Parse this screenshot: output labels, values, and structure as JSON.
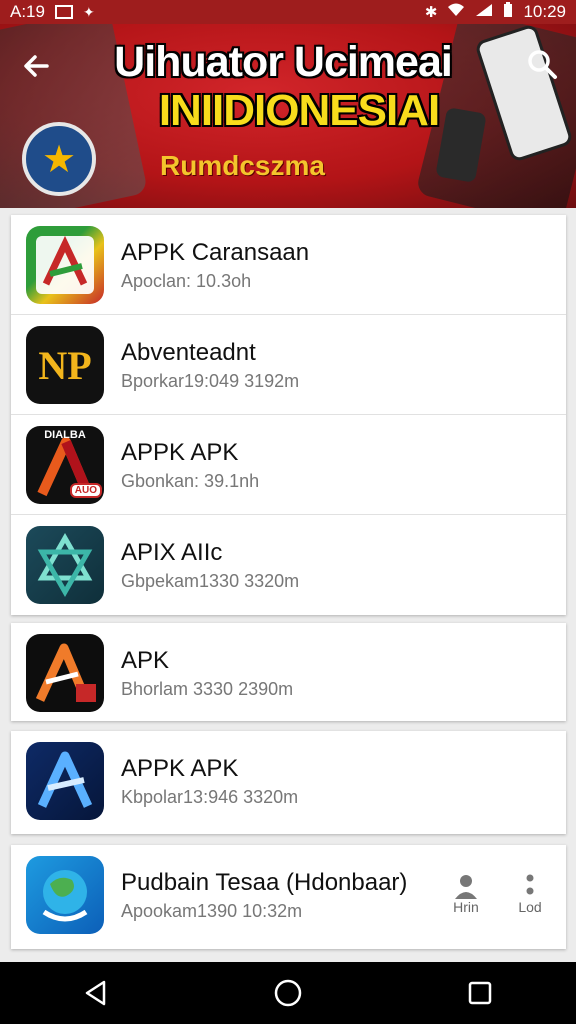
{
  "status_bar": {
    "carrier": "A:19",
    "time": "10:29"
  },
  "banner": {
    "title": "Uihuator Ucimeai",
    "subtitle": "INIIDIONESIAI",
    "tagline": "Rumdcszma",
    "back_icon": "arrow-back-icon",
    "search_icon": "search-icon"
  },
  "apps": [
    {
      "name": "APPK Caransaan",
      "meta": "Apoclan: 10.3oh",
      "icon": "apk-icon-green-red"
    },
    {
      "name": "Abventeadnt",
      "meta": "Bporkar19:049 3192m",
      "icon": "np-icon",
      "icon_text": "NP"
    },
    {
      "name": "APPK APK",
      "meta": "Gbonkan: 39.1nh",
      "icon": "a-icon-black-orange",
      "icon_top": "DIALBA",
      "icon_badge": "AUO"
    },
    {
      "name": "APIX AIIc",
      "meta": "Gbpekam1330 3320m",
      "icon": "star-icon-teal"
    },
    {
      "name": "APK",
      "meta": "Bhorlam 3330 2390m",
      "icon": "a-icon-black-red"
    },
    {
      "name": "APPK APK",
      "meta": "Kbpolar13:946 3320m",
      "icon": "a-icon-navy-blue"
    },
    {
      "name": "Pudbain Tesaa (Hdonbaar)",
      "meta": "Apookam1390 10:32m",
      "icon": "globe-icon"
    }
  ],
  "row_actions": {
    "profile_label": "Hrin",
    "more_label": "Lod"
  },
  "nav": {
    "back": "nav-back-icon",
    "home": "nav-home-icon",
    "recents": "nav-recents-icon"
  },
  "colors": {
    "banner_red": "#b31417",
    "title_yellow": "#f8dc1c",
    "nav_black": "#000000"
  }
}
